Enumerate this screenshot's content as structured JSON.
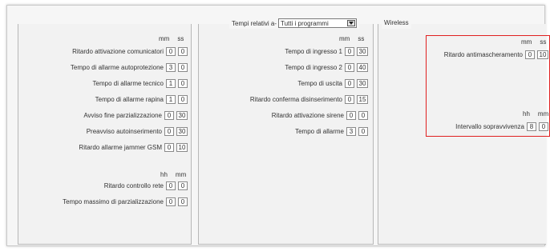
{
  "header": {
    "tempi_label": "Tempi relativi a-",
    "program_select": "Tutti i programmi",
    "wireless_label": "Wireless"
  },
  "left_panel": {
    "units_top": [
      "mm",
      "ss"
    ],
    "rows_top": [
      {
        "label": "Ritardo attivazione comunicatori",
        "a": "0",
        "b": "0"
      },
      {
        "label": "Tempo di allarme autoprotezione",
        "a": "3",
        "b": "0"
      },
      {
        "label": "Tempo di allarme tecnico",
        "a": "1",
        "b": "0"
      },
      {
        "label": "Tempo di allarme rapina",
        "a": "1",
        "b": "0"
      },
      {
        "label": "Avviso fine parzializzazione",
        "a": "0",
        "b": "30"
      },
      {
        "label": "Preavviso autoinserimento",
        "a": "0",
        "b": "30"
      },
      {
        "label": "Ritardo allarme jammer GSM",
        "a": "0",
        "b": "10"
      }
    ],
    "units_bottom": [
      "hh",
      "mm"
    ],
    "rows_bottom": [
      {
        "label": "Ritardo controllo rete",
        "a": "0",
        "b": "0"
      },
      {
        "label": "Tempo massimo di parzializzazione",
        "a": "0",
        "b": "0"
      }
    ]
  },
  "middle_panel": {
    "units": [
      "mm",
      "ss"
    ],
    "rows": [
      {
        "label": "Tempo di ingresso 1",
        "a": "0",
        "b": "30"
      },
      {
        "label": "Tempo di ingresso 2",
        "a": "0",
        "b": "40"
      },
      {
        "label": "Tempo di uscita",
        "a": "0",
        "b": "30"
      },
      {
        "label": "Ritardo conferma disinserimento",
        "a": "0",
        "b": "15"
      },
      {
        "label": "Ritardo attivazione sirene",
        "a": "0",
        "b": "0"
      },
      {
        "label": "Tempo di allarme",
        "a": "3",
        "b": "0"
      }
    ]
  },
  "right_panel": {
    "units_top": [
      "mm",
      "ss"
    ],
    "row_top": {
      "label": "Ritardo antimascheramento",
      "a": "0",
      "b": "10"
    },
    "units_bottom": [
      "hh",
      "mm"
    ],
    "row_bottom": {
      "label": "Intervallo sopravvivenza",
      "a": "8",
      "b": "0"
    },
    "highlight_color": "#e02020"
  }
}
